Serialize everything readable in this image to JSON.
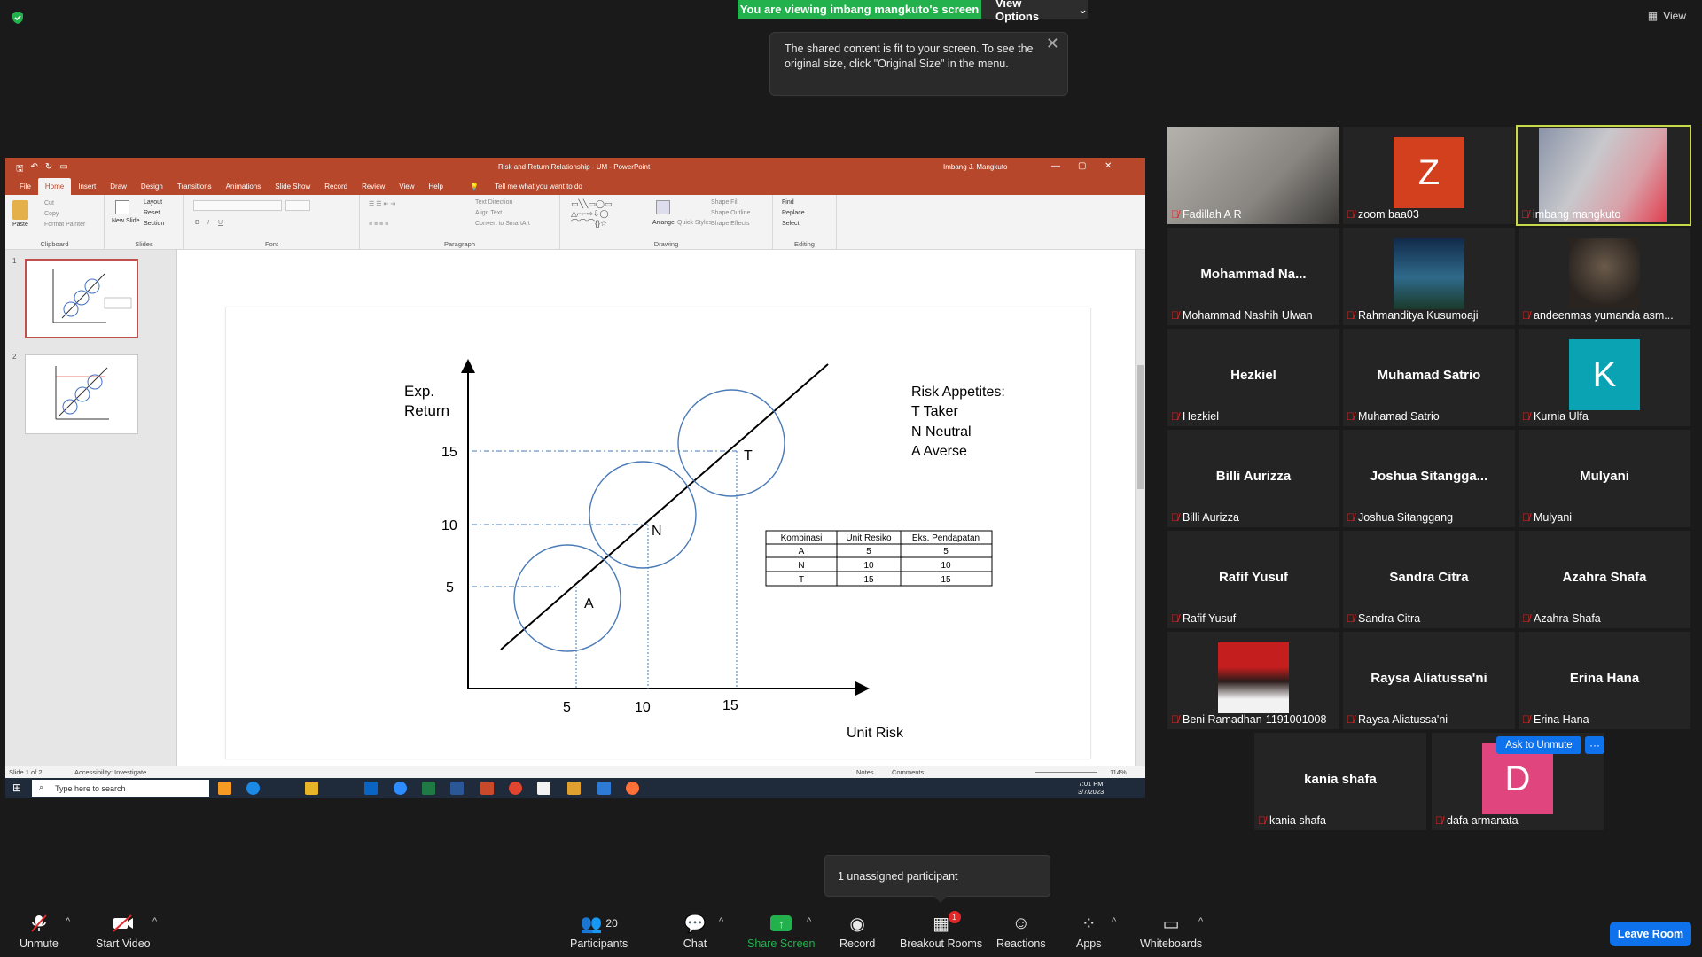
{
  "banner": {
    "viewing": "You are viewing imbang mangkuto's screen",
    "view_options": "View Options",
    "view": "View"
  },
  "tooltip": {
    "text": "The shared content is fit to your screen. To see the original size, click \"Original Size\" in the menu."
  },
  "ppt": {
    "doc_title": "Risk and Return Relationship - UM  -  PowerPoint",
    "user": "Imbang J. Mangkuto",
    "tabs": [
      "File",
      "Home",
      "Insert",
      "Draw",
      "Design",
      "Transitions",
      "Animations",
      "Slide Show",
      "Record",
      "Review",
      "View",
      "Help"
    ],
    "tell_me": "Tell me what you want to do",
    "ribbon": {
      "paste": "Paste",
      "cut": "Cut",
      "copy": "Copy",
      "format_painter": "Format Painter",
      "clipboard": "Clipboard",
      "new_slide": "New Slide",
      "layout": "Layout",
      "reset": "Reset",
      "section": "Section",
      "slides": "Slides",
      "font": "Font",
      "paragraph": "Paragraph",
      "text_direction": "Text Direction",
      "align_text": "Align Text",
      "convert_smartart": "Convert to SmartArt",
      "arrange": "Arrange",
      "quick_styles": "Quick Styles",
      "shape_fill": "Shape Fill",
      "shape_outline": "Shape Outline",
      "shape_effects": "Shape Effects",
      "drawing": "Drawing",
      "find": "Find",
      "replace": "Replace",
      "select": "Select",
      "editing": "Editing"
    },
    "thumb_nums": [
      "1",
      "2"
    ],
    "slide": {
      "ylabel_1": "Exp.",
      "ylabel_2": "Return",
      "xlabel": "Unit Risk",
      "yticks": [
        "15",
        "10",
        "5"
      ],
      "xticks": [
        "5",
        "10",
        "15"
      ],
      "circle_labels": [
        "A",
        "N",
        "T"
      ],
      "risk_title": "Risk Appetites:",
      "risk_items": [
        "T Taker",
        "N Neutral",
        "A Averse"
      ],
      "table": {
        "headers": [
          "Kombinasi",
          "Unit Resiko",
          "Eks. Pendapatan"
        ],
        "rows": [
          [
            "A",
            "5",
            "5"
          ],
          [
            "N",
            "10",
            "10"
          ],
          [
            "T",
            "15",
            "15"
          ]
        ]
      }
    },
    "status": {
      "slide_info": "Slide 1 of 2",
      "accessibility": "Accessibility: Investigate",
      "notes": "Notes",
      "comments": "Comments",
      "zoom": "114%"
    },
    "taskbar": {
      "search": "Type here to search",
      "time": "7:01 PM",
      "date": "3/7/2023"
    }
  },
  "participants": [
    {
      "name": "Fadillah A R",
      "type": "photo"
    },
    {
      "name": "zoom baa03",
      "type": "avatar",
      "initial": "Z",
      "color": "#d2401e"
    },
    {
      "name": "imbang mangkuto",
      "type": "photo",
      "speaker": true
    },
    {
      "name": "Mohammad Nashih Ulwan",
      "display": "Mohammad  Na...",
      "type": "text"
    },
    {
      "name": "Rahmanditya Kusumoaji",
      "type": "photo"
    },
    {
      "name": "andeenmas yumanda asm...",
      "type": "photo"
    },
    {
      "name": "Hezkiel",
      "display": "Hezkiel",
      "type": "text"
    },
    {
      "name": "Muhamad Satrio",
      "display": "Muhamad Satrio",
      "type": "text"
    },
    {
      "name": "Kurnia Ulfa",
      "type": "avatar",
      "initial": "K",
      "color": "#0aa3b4"
    },
    {
      "name": "Billi Aurizza",
      "display": "Billi Aurizza",
      "type": "text"
    },
    {
      "name": "Joshua Sitanggang",
      "display": "Joshua  Sitangga...",
      "type": "text"
    },
    {
      "name": "Mulyani",
      "display": "Mulyani",
      "type": "text"
    },
    {
      "name": "Rafif Yusuf",
      "display": "Rafif Yusuf",
      "type": "text"
    },
    {
      "name": "Sandra Citra",
      "display": "Sandra Citra",
      "type": "text"
    },
    {
      "name": "Azahra Shafa",
      "display": "Azahra Shafa",
      "type": "text"
    },
    {
      "name": "Beni Ramadhan-1191001008",
      "type": "photo"
    },
    {
      "name": "Raysa Aliatussa'ni",
      "display": "Raysa Aliatussa'ni",
      "type": "text"
    },
    {
      "name": "Erina Hana",
      "display": "Erina Hana",
      "type": "text"
    },
    {
      "name": "kania shafa",
      "display": "kania shafa",
      "type": "text"
    },
    {
      "name": "dafa armanata",
      "type": "avatar",
      "initial": "D",
      "color": "#e0467d"
    }
  ],
  "ask_to_unmute": "Ask to Unmute",
  "more": "···",
  "unassigned": "1 unassigned participant",
  "toolbar": {
    "unmute": "Unmute",
    "start_video": "Start Video",
    "participants": "Participants",
    "participant_count": "20",
    "chat": "Chat",
    "share_screen": "Share Screen",
    "record": "Record",
    "breakout": "Breakout Rooms",
    "breakout_badge": "1",
    "reactions": "Reactions",
    "apps": "Apps",
    "whiteboards": "Whiteboards",
    "leave": "Leave Room"
  },
  "colors": {
    "zoom_green": "#23b14d",
    "zoom_blue": "#0e72ed",
    "ppt_red": "#b7472a",
    "speaker_border": "#c8d94a"
  }
}
